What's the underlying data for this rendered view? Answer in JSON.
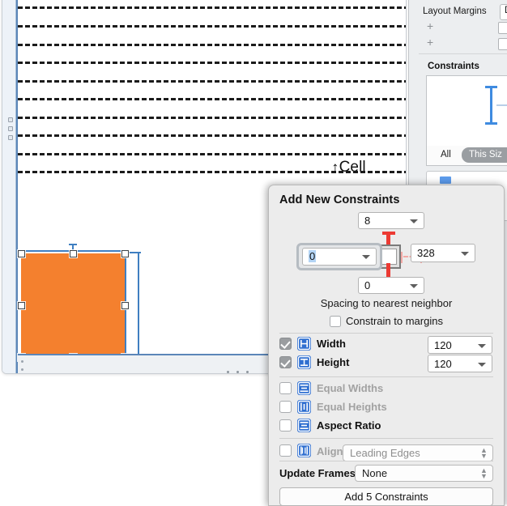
{
  "canvas": {
    "cell_callout": "Cell",
    "cell_callout_arrow": "↑",
    "selected_view_color": "#f4802e",
    "separator_count": 10
  },
  "inspector": {
    "layout_margins_label": "Layout Margins",
    "layout_margins_value": "D",
    "plus_row_1": "+",
    "plus_row_2": "+",
    "constraints_header": "Constraints",
    "segment_all": "All",
    "segment_this_size": "This Siz"
  },
  "popover": {
    "title": "Add New Constraints",
    "top_spacing": {
      "value": "8"
    },
    "left_spacing": {
      "value": "0",
      "focused": true
    },
    "right_spacing": {
      "value": "328"
    },
    "bottom_spacing": {
      "value": "0"
    },
    "spacing_note": "Spacing to nearest neighbor",
    "constrain_to_margins": {
      "label": "Constrain to margins",
      "checked": false
    },
    "options": [
      {
        "name": "width",
        "label": "Width",
        "checked": true,
        "enabled": true,
        "icon": "width-icon",
        "value": "120"
      },
      {
        "name": "height",
        "label": "Height",
        "checked": true,
        "enabled": true,
        "icon": "height-icon",
        "value": "120"
      },
      {
        "name": "equal-widths",
        "label": "Equal Widths",
        "checked": false,
        "enabled": false,
        "icon": "equal-widths-icon",
        "value": null
      },
      {
        "name": "equal-heights",
        "label": "Equal Heights",
        "checked": false,
        "enabled": false,
        "icon": "equal-heights-icon",
        "value": null
      },
      {
        "name": "aspect-ratio",
        "label": "Aspect Ratio",
        "checked": false,
        "enabled": true,
        "icon": "aspect-ratio-icon",
        "value": null
      }
    ],
    "align": {
      "label": "Align",
      "checked": false,
      "enabled": false,
      "value": "Leading Edges"
    },
    "update_frames": {
      "label": "Update Frames",
      "value": "None"
    },
    "add_button": "Add 5 Constraints"
  }
}
